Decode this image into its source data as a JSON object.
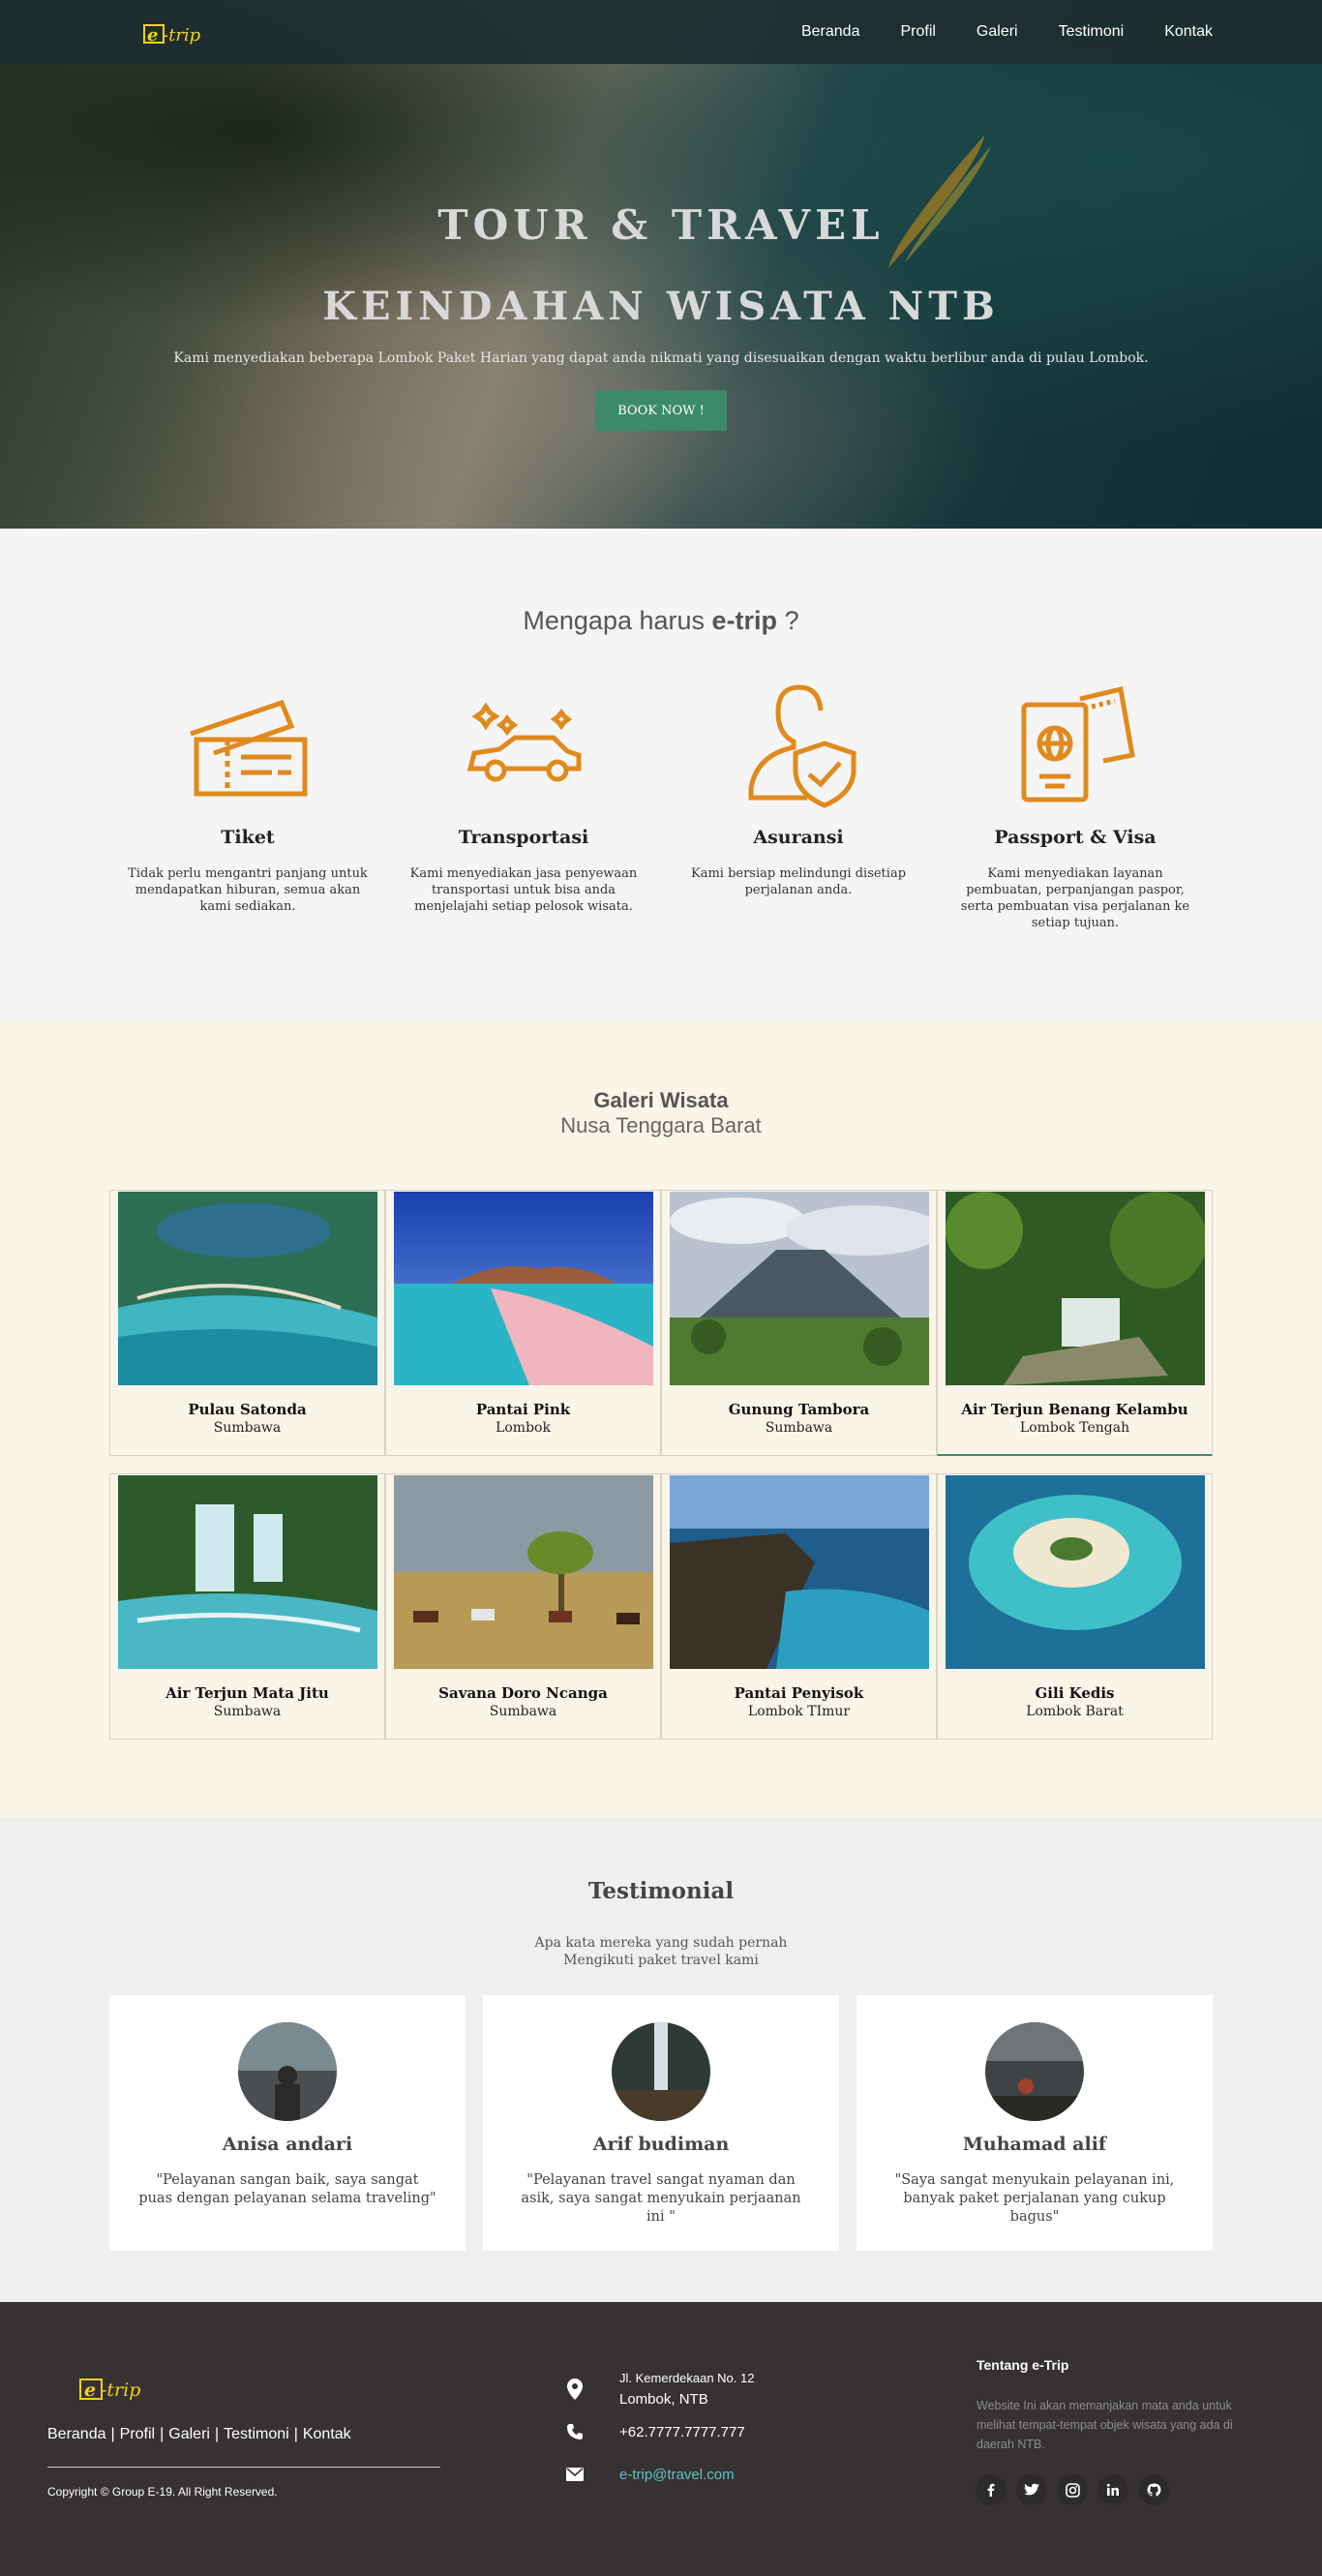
{
  "brand": {
    "logo_text": "e-trip"
  },
  "nav": {
    "items": [
      "Beranda",
      "Profil",
      "Galeri",
      "Testimoni",
      "Kontak"
    ]
  },
  "hero": {
    "title_line1": "TOUR & TRAVEL",
    "title_line2": "KEINDAHAN WISATA NTB",
    "subtitle": "Kami menyediakan beberapa Lombok Paket Harian yang dapat anda nikmati yang disesuaikan dengan waktu berlibur anda di pulau Lombok.",
    "cta_label": "BOOK NOW !"
  },
  "why": {
    "title_prefix": "Mengapa harus",
    "title_brand": "e-trip",
    "title_suffix": "?",
    "features": [
      {
        "icon": "ticket-icon",
        "title": "Tiket",
        "text": "Tidak perlu mengantri panjang untuk mendapatkan hiburan, semua akan kami sediakan."
      },
      {
        "icon": "car-icon",
        "title": "Transportasi",
        "text": "Kami menyediakan jasa penyewaan transportasi untuk bisa anda menjelajahi setiap pelosok wisata."
      },
      {
        "icon": "user-shield-icon",
        "title": "Asuransi",
        "text": "Kami bersiap melindungi disetiap perjalanan anda."
      },
      {
        "icon": "passport-icon",
        "title": "Passport & Visa",
        "text": "Kami menyediakan layanan pembuatan, perpanjangan paspor, serta pembuatan visa perjalanan ke setiap tujuan."
      }
    ]
  },
  "gallery": {
    "title": "Galeri Wisata",
    "subtitle": "Nusa Tenggara Barat",
    "items": [
      {
        "name": "Pulau Satonda",
        "region": "Sumbawa"
      },
      {
        "name": "Pantai Pink",
        "region": "Lombok"
      },
      {
        "name": "Gunung Tambora",
        "region": "Sumbawa"
      },
      {
        "name": "Air Terjun Benang Kelambu",
        "region": "Lombok Tengah"
      },
      {
        "name": "Air Terjun Mata Jitu",
        "region": "Sumbawa"
      },
      {
        "name": "Savana Doro Ncanga",
        "region": "Sumbawa"
      },
      {
        "name": "Pantai Penyisok",
        "region": "Lombok TImur"
      },
      {
        "name": "Gili Kedis",
        "region": "Lombok Barat"
      }
    ]
  },
  "testimonial": {
    "title": "Testimonial",
    "subtitle_line1": "Apa kata mereka yang sudah pernah",
    "subtitle_line2": "Mengikuti paket travel kami",
    "items": [
      {
        "name": "Anisa andari",
        "quote": "\"Pelayanan sangan baik, saya sangat puas dengan pelayanan selama traveling\""
      },
      {
        "name": "Arif budiman",
        "quote": "\"Pelayanan travel sangat nyaman dan asik, saya sangat menyukain perjaanan ini \""
      },
      {
        "name": "Muhamad alif",
        "quote": "\"Saya sangat menyukain pelayanan ini, banyak paket perjalanan yang cukup bagus\""
      }
    ]
  },
  "footer": {
    "links": [
      "Beranda",
      "Profil",
      "Galeri",
      "Testimoni",
      "Kontak"
    ],
    "copyright": "Copyright © Group E-19. All Right Reserved.",
    "address_line1": "Jl. Kemerdekaan No. 12",
    "address_line2": "Lombok, NTB",
    "phone": "+62.7777.7777.777",
    "email": "e-trip@travel.com",
    "about_title": "Tentang e-Trip",
    "about_text": "Website Ini akan memanjakan mata anda untuk melihat tempat-tempat objek wisata yang ada di daerah NTB.",
    "socials": [
      "facebook-icon",
      "twitter-icon",
      "instagram-icon",
      "linkedin-icon",
      "github-icon"
    ]
  },
  "colors": {
    "accent": "#3c8a6a",
    "icon_orange": "#e08a1e",
    "footer_bg": "#363233",
    "gallery_bg": "#fbf4e8"
  }
}
